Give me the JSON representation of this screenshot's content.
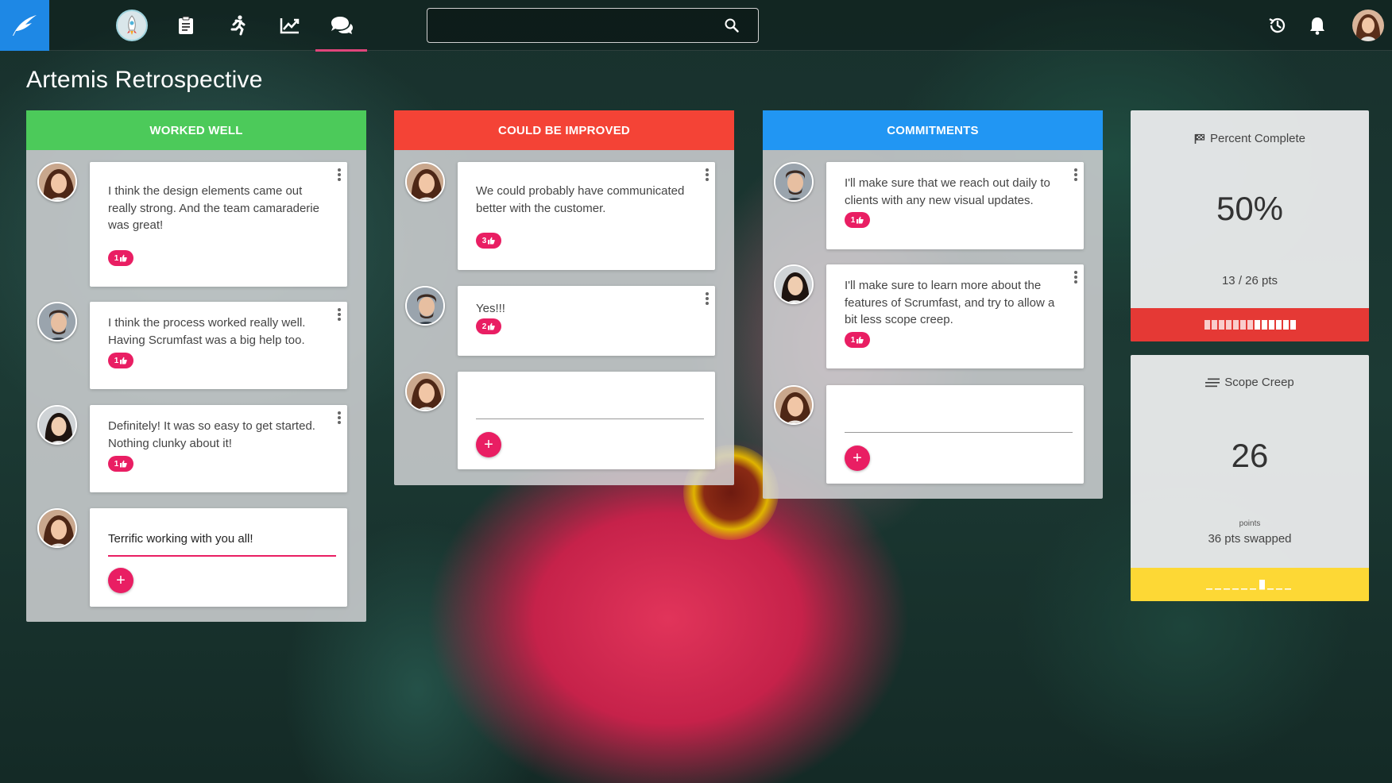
{
  "nav": {
    "search_placeholder": "",
    "active_item": "retrospectives"
  },
  "page": {
    "title": "Artemis Retrospective"
  },
  "columns": {
    "worked_well": {
      "title": "WORKED WELL",
      "color": "#4cca5a",
      "cards": [
        {
          "text": "I think the design elements came out really strong.  And the team camaraderie was great!",
          "likes": "1"
        },
        {
          "text": "I think the process worked really well.  Having Scrumfast was a big help too.",
          "likes": "1"
        },
        {
          "text": "Definitely! It was so easy to get started. Nothing clunky about it!",
          "likes": "1"
        }
      ],
      "draft": "Terrific working with you all!"
    },
    "could_be_improved": {
      "title": "COULD BE IMPROVED",
      "color": "#f44336",
      "cards": [
        {
          "text": "We could probably have communicated better with the customer.",
          "likes": "3"
        },
        {
          "text": "Yes!!!",
          "likes": "2"
        }
      ],
      "draft": ""
    },
    "commitments": {
      "title": "COMMITMENTS",
      "color": "#2196f3",
      "cards": [
        {
          "text": "I'll make sure that we reach out daily to clients with any new visual updates.",
          "likes": "1"
        },
        {
          "text": "I'll make sure to learn more about the features of Scrumfast, and try to allow a bit less scope creep.",
          "likes": "1"
        }
      ],
      "draft": ""
    }
  },
  "stats": {
    "percent_complete": {
      "label": "Percent Complete",
      "value": "50%",
      "detail": "13 / 26 pts",
      "fraction": 0.5,
      "band_color": "#e53935"
    },
    "scope_creep": {
      "label": "Scope Creep",
      "value": "26",
      "unit": "points",
      "detail": "36 pts swapped",
      "band_color": "#fdd835"
    }
  }
}
